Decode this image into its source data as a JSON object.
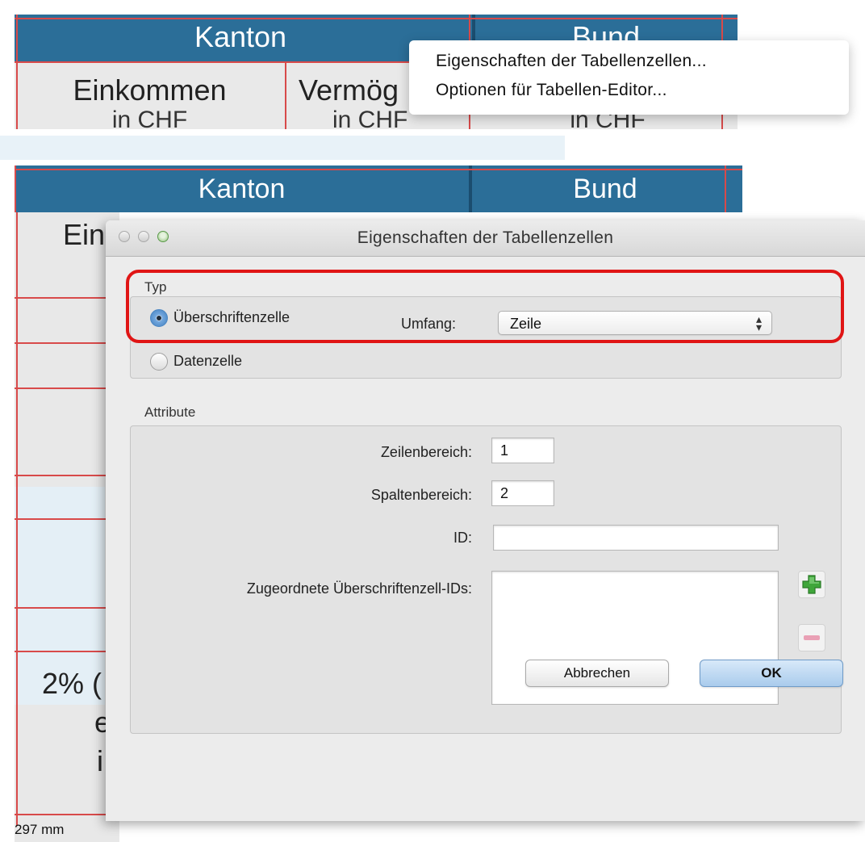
{
  "top_table": {
    "kanton": "Kanton",
    "bund": "Bund",
    "col1_title": "Einkommen",
    "col1_unit": "in CHF",
    "col2_title": "Vermög",
    "col2_unit": "in CHF",
    "col3_unit": "in CHF"
  },
  "context_menu": {
    "items": [
      "Eigenschaften der Tabellenzellen...",
      "Optionen für Tabellen-Editor..."
    ]
  },
  "bg_table": {
    "kanton": "Kanton",
    "bund": "Bund",
    "cell_ein": "Ein",
    "cell_2pct": "2% (",
    "cell_e": "e",
    "cell_i": "i",
    "ruler_label": "297 mm"
  },
  "dialog": {
    "title": "Eigenschaften der Tabellenzellen",
    "typ": {
      "label": "Typ",
      "header_cell": "Überschriftenzelle",
      "data_cell": "Datenzelle",
      "selected": "Überschriftenzelle",
      "scope_label": "Umfang:",
      "scope_value": "Zeile"
    },
    "attribute": {
      "label": "Attribute",
      "row_span_label": "Zeilenbereich:",
      "row_span_value": "1",
      "col_span_label": "Spaltenbereich:",
      "col_span_value": "2",
      "id_label": "ID:",
      "id_value": "",
      "header_ids_label": "Zugeordnete Überschriftenzell-IDs:",
      "header_ids_value": ""
    },
    "buttons": {
      "cancel": "Abbrechen",
      "ok": "OK"
    }
  },
  "colors": {
    "table_header": "#2b6e98",
    "highlight": "#e01515",
    "grid_lines": "#d84a4a"
  },
  "icons": [
    "add-icon",
    "remove-icon",
    "radio-button",
    "stepper-arrows-icon"
  ]
}
